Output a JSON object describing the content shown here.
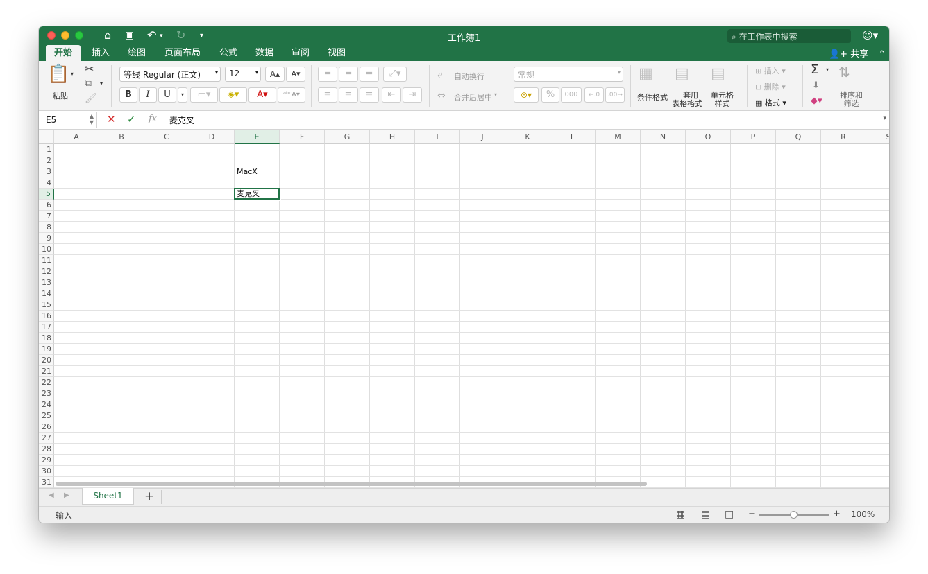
{
  "window": {
    "title": "工作簿1"
  },
  "search": {
    "placeholder": "在工作表中搜索"
  },
  "tabs": [
    {
      "label": "开始",
      "active": true
    },
    {
      "label": "插入"
    },
    {
      "label": "绘图"
    },
    {
      "label": "页面布局"
    },
    {
      "label": "公式"
    },
    {
      "label": "数据"
    },
    {
      "label": "审阅"
    },
    {
      "label": "视图"
    }
  ],
  "share": {
    "label": "共享"
  },
  "ribbon": {
    "paste_label": "粘贴",
    "font_name": "等线 Regular (正文)",
    "font_size": "12",
    "bold": "B",
    "italic": "I",
    "underline": "U",
    "wrap_text": "自动换行",
    "merge_center": "合并后居中",
    "number_format": "常规",
    "percent": "%",
    "thousands": "000",
    "conditional_format": "条件格式",
    "table_format": "套用\n表格格式",
    "table_format_1": "套用",
    "table_format_2": "表格格式",
    "cell_style_1": "单元格",
    "cell_style_2": "样式",
    "insert": "插入",
    "delete": "删除",
    "format": "格式",
    "sort_filter_1": "排序和",
    "sort_filter_2": "筛选",
    "sum_icon": "Σ"
  },
  "formula_bar": {
    "name_box": "E5",
    "fx": "fx",
    "content": "麦克叉"
  },
  "columns": [
    "A",
    "B",
    "C",
    "D",
    "E",
    "F",
    "G",
    "H",
    "I",
    "J",
    "K",
    "L",
    "M",
    "N",
    "O",
    "P",
    "Q",
    "R",
    "S"
  ],
  "rows": [
    "1",
    "2",
    "3",
    "4",
    "5",
    "6",
    "7",
    "8",
    "9",
    "10",
    "11",
    "12",
    "13",
    "14",
    "15",
    "16",
    "17",
    "18",
    "19",
    "20",
    "21",
    "22",
    "23",
    "24",
    "25",
    "26",
    "27",
    "28",
    "29",
    "30",
    "31"
  ],
  "cells": {
    "E3": "MacX",
    "E5": "麦克叉"
  },
  "selected_cell": "E5",
  "sheets": [
    "Sheet1"
  ],
  "add_sheet": "+",
  "status": {
    "mode": "输入",
    "zoom": "100%",
    "zoom_out": "−",
    "zoom_in": "+"
  },
  "colors": {
    "accent": "#217346",
    "ribbon_bg": "#f3f3f3"
  }
}
